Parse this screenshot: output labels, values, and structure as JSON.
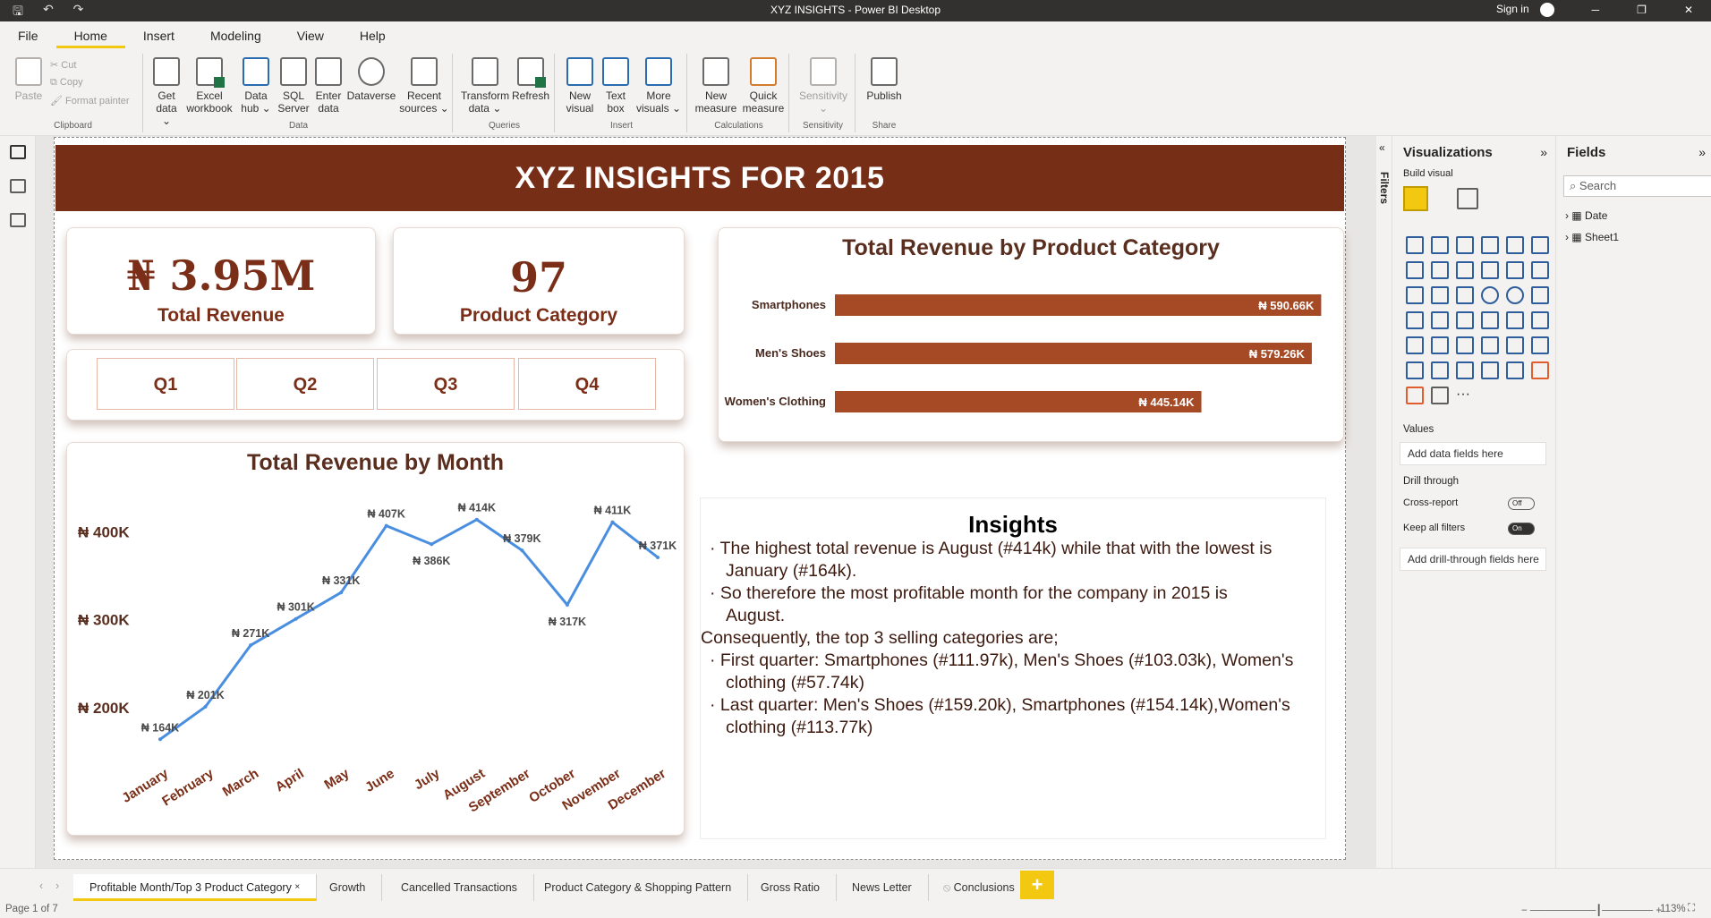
{
  "window": {
    "title": "XYZ INSIGHTS - Power BI Desktop",
    "sign_in": "Sign in",
    "min": "─",
    "restore": "❐",
    "close": "✕"
  },
  "menu": [
    "File",
    "Home",
    "Insert",
    "Modeling",
    "View",
    "Help"
  ],
  "ribbon": {
    "clipboard": {
      "paste": "Paste",
      "cut": "Cut",
      "copy": "Copy",
      "format_painter": "Format painter",
      "label": "Clipboard"
    },
    "data": {
      "buttons": [
        "Get data ⌄",
        "Excel workbook",
        "Data hub ⌄",
        "SQL Server",
        "Enter data",
        "Dataverse",
        "Recent sources ⌄"
      ],
      "label": "Data"
    },
    "queries": {
      "buttons": [
        "Transform data ⌄",
        "Refresh"
      ],
      "label": "Queries"
    },
    "insert": {
      "buttons": [
        "New visual",
        "Text box",
        "More visuals ⌄"
      ],
      "label": "Insert"
    },
    "calculations": {
      "buttons": [
        "New measure",
        "Quick measure"
      ],
      "label": "Calculations"
    },
    "sensitivity": {
      "buttons": [
        "Sensitivity ⌄"
      ],
      "label": "Sensitivity"
    },
    "share": {
      "buttons": [
        "Publish"
      ],
      "label": "Share"
    }
  },
  "report": {
    "banner": "XYZ INSIGHTS FOR  2015",
    "kpi_revenue": {
      "value": "₦ 3.95M",
      "label": "Total Revenue"
    },
    "kpi_category": {
      "value": "97",
      "label": "Product Category"
    },
    "quarters": [
      "Q1",
      "Q2",
      "Q3",
      "Q4"
    ],
    "insights": {
      "title": "Insights",
      "lines": [
        "·  The highest total revenue is August (#414k) while that with the lowest is",
        "   January (#164k).",
        "· So therefore the most profitable month for the company in 2015 is",
        "   August.",
        "Consequently, the top 3 selling categories are;",
        "· First quarter: Smartphones (#111.97k), Men's Shoes (#103.03k), Women's",
        "   clothing (#57.74k)",
        "· Last quarter:  Men's Shoes (#159.20k), Smartphones (#154.14k),Women's",
        "   clothing (#113.77k)"
      ]
    }
  },
  "chart_data": [
    {
      "type": "line",
      "title": "Total Revenue by Month",
      "categories": [
        "January",
        "February",
        "March",
        "April",
        "May",
        "June",
        "July",
        "August",
        "September",
        "October",
        "November",
        "December"
      ],
      "values": [
        164,
        201,
        271,
        301,
        331,
        407,
        386,
        414,
        379,
        317,
        411,
        371
      ],
      "labels": [
        "₦ 164K",
        "₦ 201K",
        "₦ 271K",
        "₦ 301K",
        "₦ 331K",
        "₦ 407K",
        "₦ 386K",
        "₦ 414K",
        "₦ 379K",
        "₦ 317K",
        "₦ 411K",
        "₦ 371K"
      ],
      "yticks": [
        "₦ 200K",
        "₦ 300K",
        "₦ 400K"
      ],
      "ytick_values": [
        200,
        300,
        400
      ],
      "ylim": [
        150,
        430
      ],
      "color": "#4a8ee0"
    },
    {
      "type": "bar",
      "title": "Total Revenue by Product Category",
      "categories": [
        "Smartphones",
        "Men's Shoes",
        "Women's Clothing"
      ],
      "values": [
        590.66,
        579.26,
        445.14
      ],
      "labels": [
        "₦ 590.66K",
        "₦ 579.26K",
        "₦ 445.14K"
      ],
      "color": "#a64a26"
    }
  ],
  "filters_label": "Filters",
  "viz_pane": {
    "title": "Visualizations",
    "build": "Build visual",
    "values": "Values",
    "add_data": "Add data fields here",
    "drill": "Drill through",
    "cross": "Cross-report",
    "cross_state": "Off",
    "keep": "Keep all filters",
    "keep_state": "On",
    "add_drill": "Add drill-through fields here"
  },
  "fields_pane": {
    "title": "Fields",
    "search": "Search",
    "tables": [
      "Date",
      "Sheet1"
    ]
  },
  "tabs": [
    "Profitable Month/Top 3 Product Category",
    "Growth",
    "Cancelled Transactions",
    "Product Category & Shopping Pattern",
    "Gross Ratio",
    "News Letter",
    "Conclusions"
  ],
  "status": {
    "page": "Page 1 of 7",
    "zoom": "113%"
  }
}
